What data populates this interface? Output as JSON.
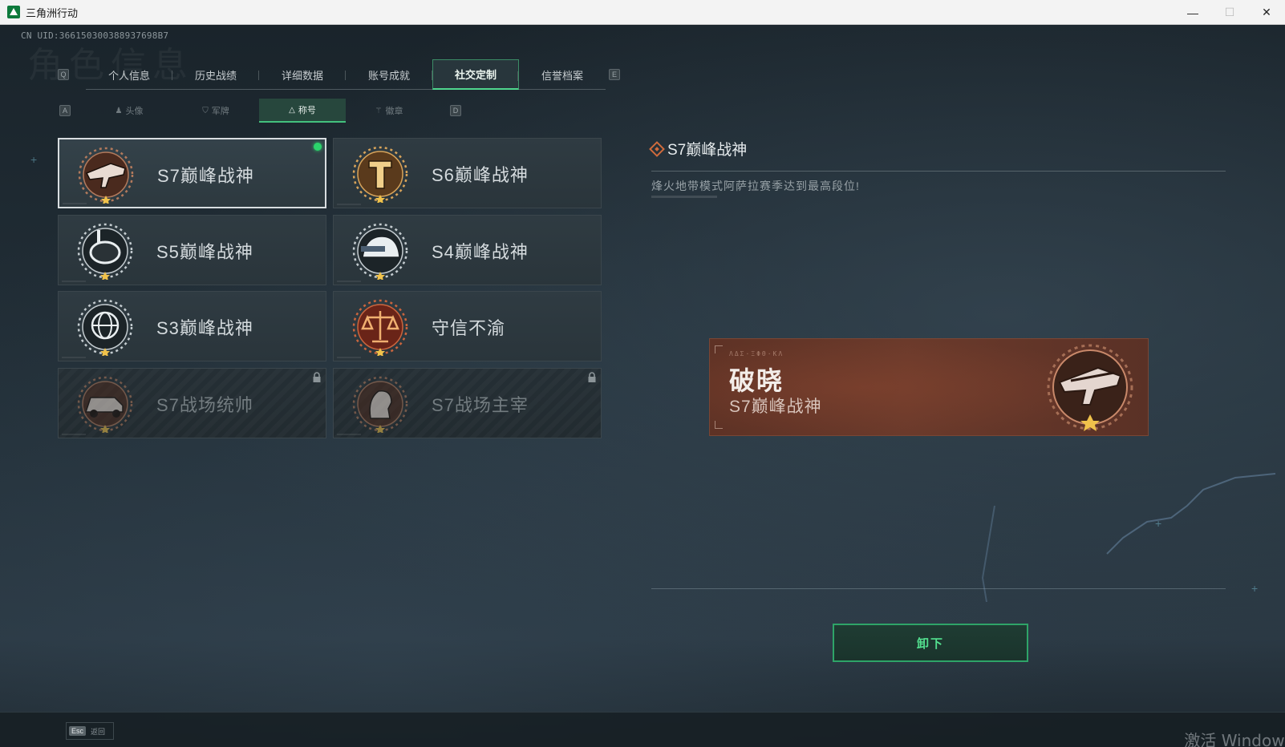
{
  "window": {
    "title": "三角洲行动",
    "minimize": "—",
    "maximize": "☐",
    "close": "✕"
  },
  "uid": "CN UID:366150300388937698B7",
  "watermark": "角色信息",
  "main_tabs": {
    "left_key": "Q",
    "right_key": "E",
    "items": [
      {
        "label": "个人信息"
      },
      {
        "label": "历史战绩"
      },
      {
        "label": "详细数据"
      },
      {
        "label": "账号成就"
      },
      {
        "label": "社交定制"
      },
      {
        "label": "信誉档案"
      }
    ],
    "active_index": 4
  },
  "sub_tabs": {
    "left_key": "A",
    "right_key": "D",
    "items": [
      {
        "label": "头像",
        "icon": "person-icon"
      },
      {
        "label": "军牌",
        "icon": "tag-icon"
      },
      {
        "label": "称号",
        "icon": "triangle-icon"
      },
      {
        "label": "徽章",
        "icon": "wing-icon"
      }
    ],
    "active_index": 2
  },
  "titles": [
    {
      "name": "S7巅峰战神",
      "emblem": "gun-emblem-icon",
      "theme": "bronze",
      "selected": true,
      "equipped": true,
      "locked": false
    },
    {
      "name": "S6巅峰战神",
      "emblem": "pillar-emblem-icon",
      "theme": "gold",
      "selected": false,
      "equipped": false,
      "locked": false
    },
    {
      "name": "S5巅峰战神",
      "emblem": "diver-mask-emblem-icon",
      "theme": "silver",
      "selected": false,
      "equipped": false,
      "locked": false
    },
    {
      "name": "S4巅峰战神",
      "emblem": "helmet-emblem-icon",
      "theme": "silver",
      "selected": false,
      "equipped": false,
      "locked": false
    },
    {
      "name": "S3巅峰战神",
      "emblem": "globe-emblem-icon",
      "theme": "silver",
      "selected": false,
      "equipped": false,
      "locked": false
    },
    {
      "name": "守信不渝",
      "emblem": "scales-emblem-icon",
      "theme": "red",
      "selected": false,
      "equipped": false,
      "locked": false
    },
    {
      "name": "S7战场统帅",
      "emblem": "vehicle-emblem-icon",
      "theme": "bronze",
      "selected": false,
      "equipped": false,
      "locked": true
    },
    {
      "name": "S7战场主宰",
      "emblem": "soldier-emblem-icon",
      "theme": "bronze",
      "selected": false,
      "equipped": false,
      "locked": true
    }
  ],
  "detail": {
    "title": "S7巅峰战神",
    "description": "烽火地带模式阿萨拉赛季达到最高段位!"
  },
  "preview": {
    "tiny_text": "ΛΔΣ·ΞΦΘ·ΚΛ",
    "player_name": "破晓",
    "title_name": "S7巅峰战神"
  },
  "unequip_button": "卸下",
  "footer": {
    "esc_key": "Esc",
    "esc_label": "返回",
    "activate_windows": "激活 Windows"
  },
  "colors": {
    "accent_green": "#4fd68e",
    "equipped_dot": "#2bd36b",
    "banner_bronze": "#6b3a2b"
  }
}
